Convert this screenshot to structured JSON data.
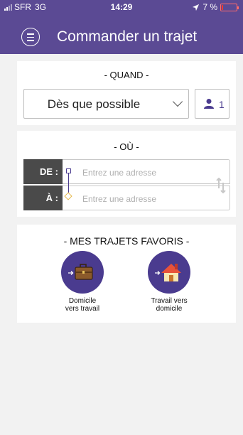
{
  "status_bar": {
    "carrier": "SFR",
    "network": "3G",
    "time": "14:29",
    "battery": "7 %"
  },
  "header": {
    "title": "Commander un trajet",
    "menu_icon": "menu-icon"
  },
  "when": {
    "title": "- QUAND -",
    "selected": "Dès que possible",
    "passengers": "1"
  },
  "where": {
    "title": "- OÙ -",
    "from_label": "DE :",
    "from_placeholder": "Entrez une adresse",
    "to_label": "À :",
    "to_placeholder": "Entrez une adresse"
  },
  "favorites": {
    "title": "- MES TRAJETS FAVORIS -",
    "items": [
      {
        "line1": "Domicile",
        "line2": "vers travail",
        "icon": "briefcase-icon"
      },
      {
        "line1": "Travail vers",
        "line2": "domicile",
        "icon": "house-icon"
      }
    ]
  },
  "colors": {
    "brand": "#5b4a94",
    "accent": "#4a3b8f",
    "destination": "#e5b84a"
  }
}
